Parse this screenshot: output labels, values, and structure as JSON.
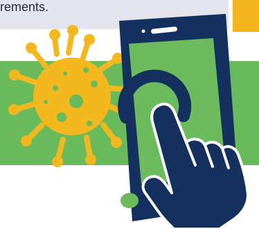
{
  "text_card": {
    "visible_text": "rements."
  },
  "colors": {
    "card_background": "#e4e4ee",
    "accent_yellow": "#f4b520",
    "green_band": "#68ba5b",
    "virus_yellow": "#f3b81d",
    "phone_navy": "#14305f",
    "screen_green": "#6cbc5d"
  },
  "illustration": {
    "subject_icons": [
      "virus-icon",
      "phone-icon",
      "tap-ring-icon",
      "hand-icon"
    ]
  }
}
